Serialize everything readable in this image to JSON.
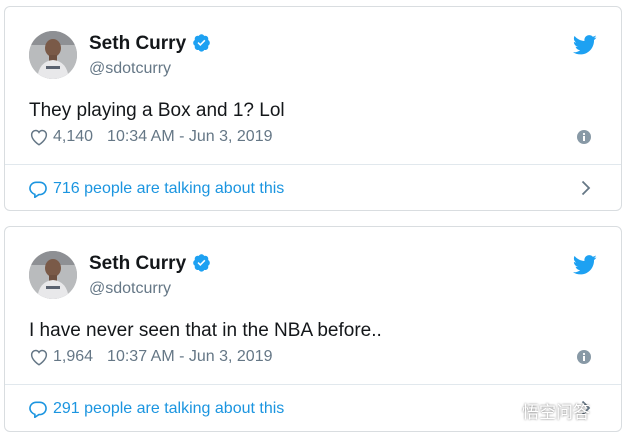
{
  "colors": {
    "accent": "#1b95e0",
    "text": "#14171a",
    "muted": "#657786",
    "border": "#d9dde0"
  },
  "tweets": [
    {
      "author_name": "Seth Curry",
      "handle": "@sdotcurry",
      "text": "They playing a Box and 1? Lol",
      "likes": "4,140",
      "timestamp": "10:34 AM - Jun 3, 2019",
      "talking": "716 people are talking about this",
      "icons": [
        "verified-badge-icon",
        "twitter-bird-icon",
        "heart-icon",
        "info-icon",
        "speech-bubble-icon",
        "chevron-right-icon"
      ]
    },
    {
      "author_name": "Seth Curry",
      "handle": "@sdotcurry",
      "text": "I have never seen that in the NBA before..",
      "likes": "1,964",
      "timestamp": "10:37 AM - Jun 3, 2019",
      "talking": "291 people are talking about this",
      "icons": [
        "verified-badge-icon",
        "twitter-bird-icon",
        "heart-icon",
        "info-icon",
        "speech-bubble-icon",
        "chevron-right-icon"
      ]
    }
  ],
  "watermark": {
    "text": "悟空问答"
  }
}
